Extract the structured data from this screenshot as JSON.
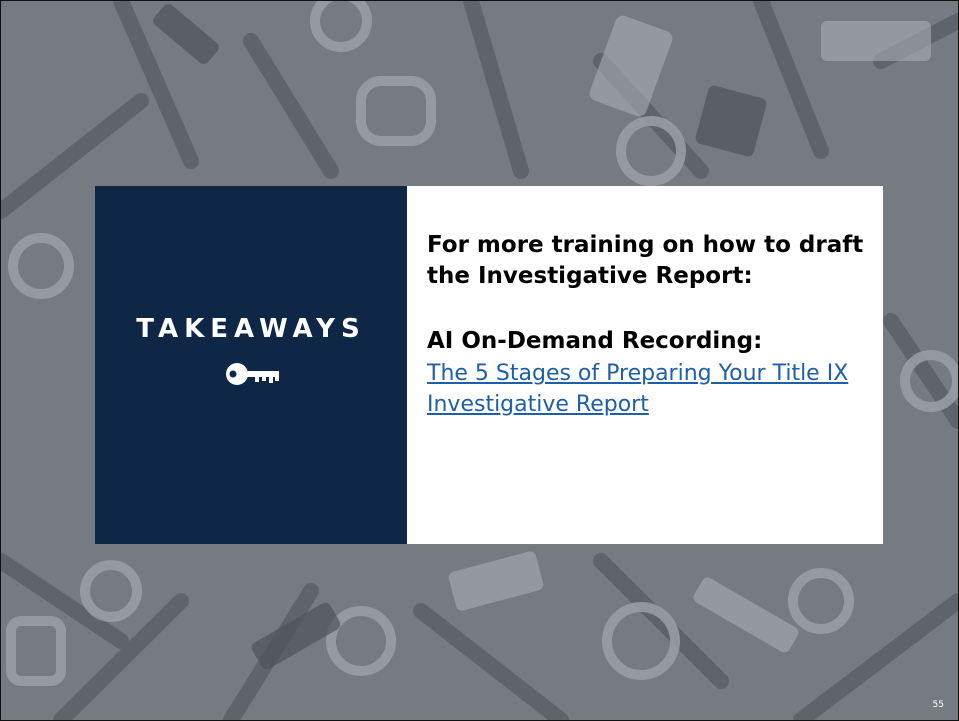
{
  "takeaways_title": "TAKEAWAYS",
  "icon": "key-icon",
  "content": {
    "heading": "For more training on how to draft the Investigative Report:",
    "recording_label": "AI On-Demand Recording:",
    "recording_link": "The 5 Stages of Preparing Your Title IX Investigative Report"
  },
  "page_number": "55",
  "colors": {
    "navy": "#0f2746",
    "link": "#1f5fa8",
    "background": "#7b8086"
  }
}
